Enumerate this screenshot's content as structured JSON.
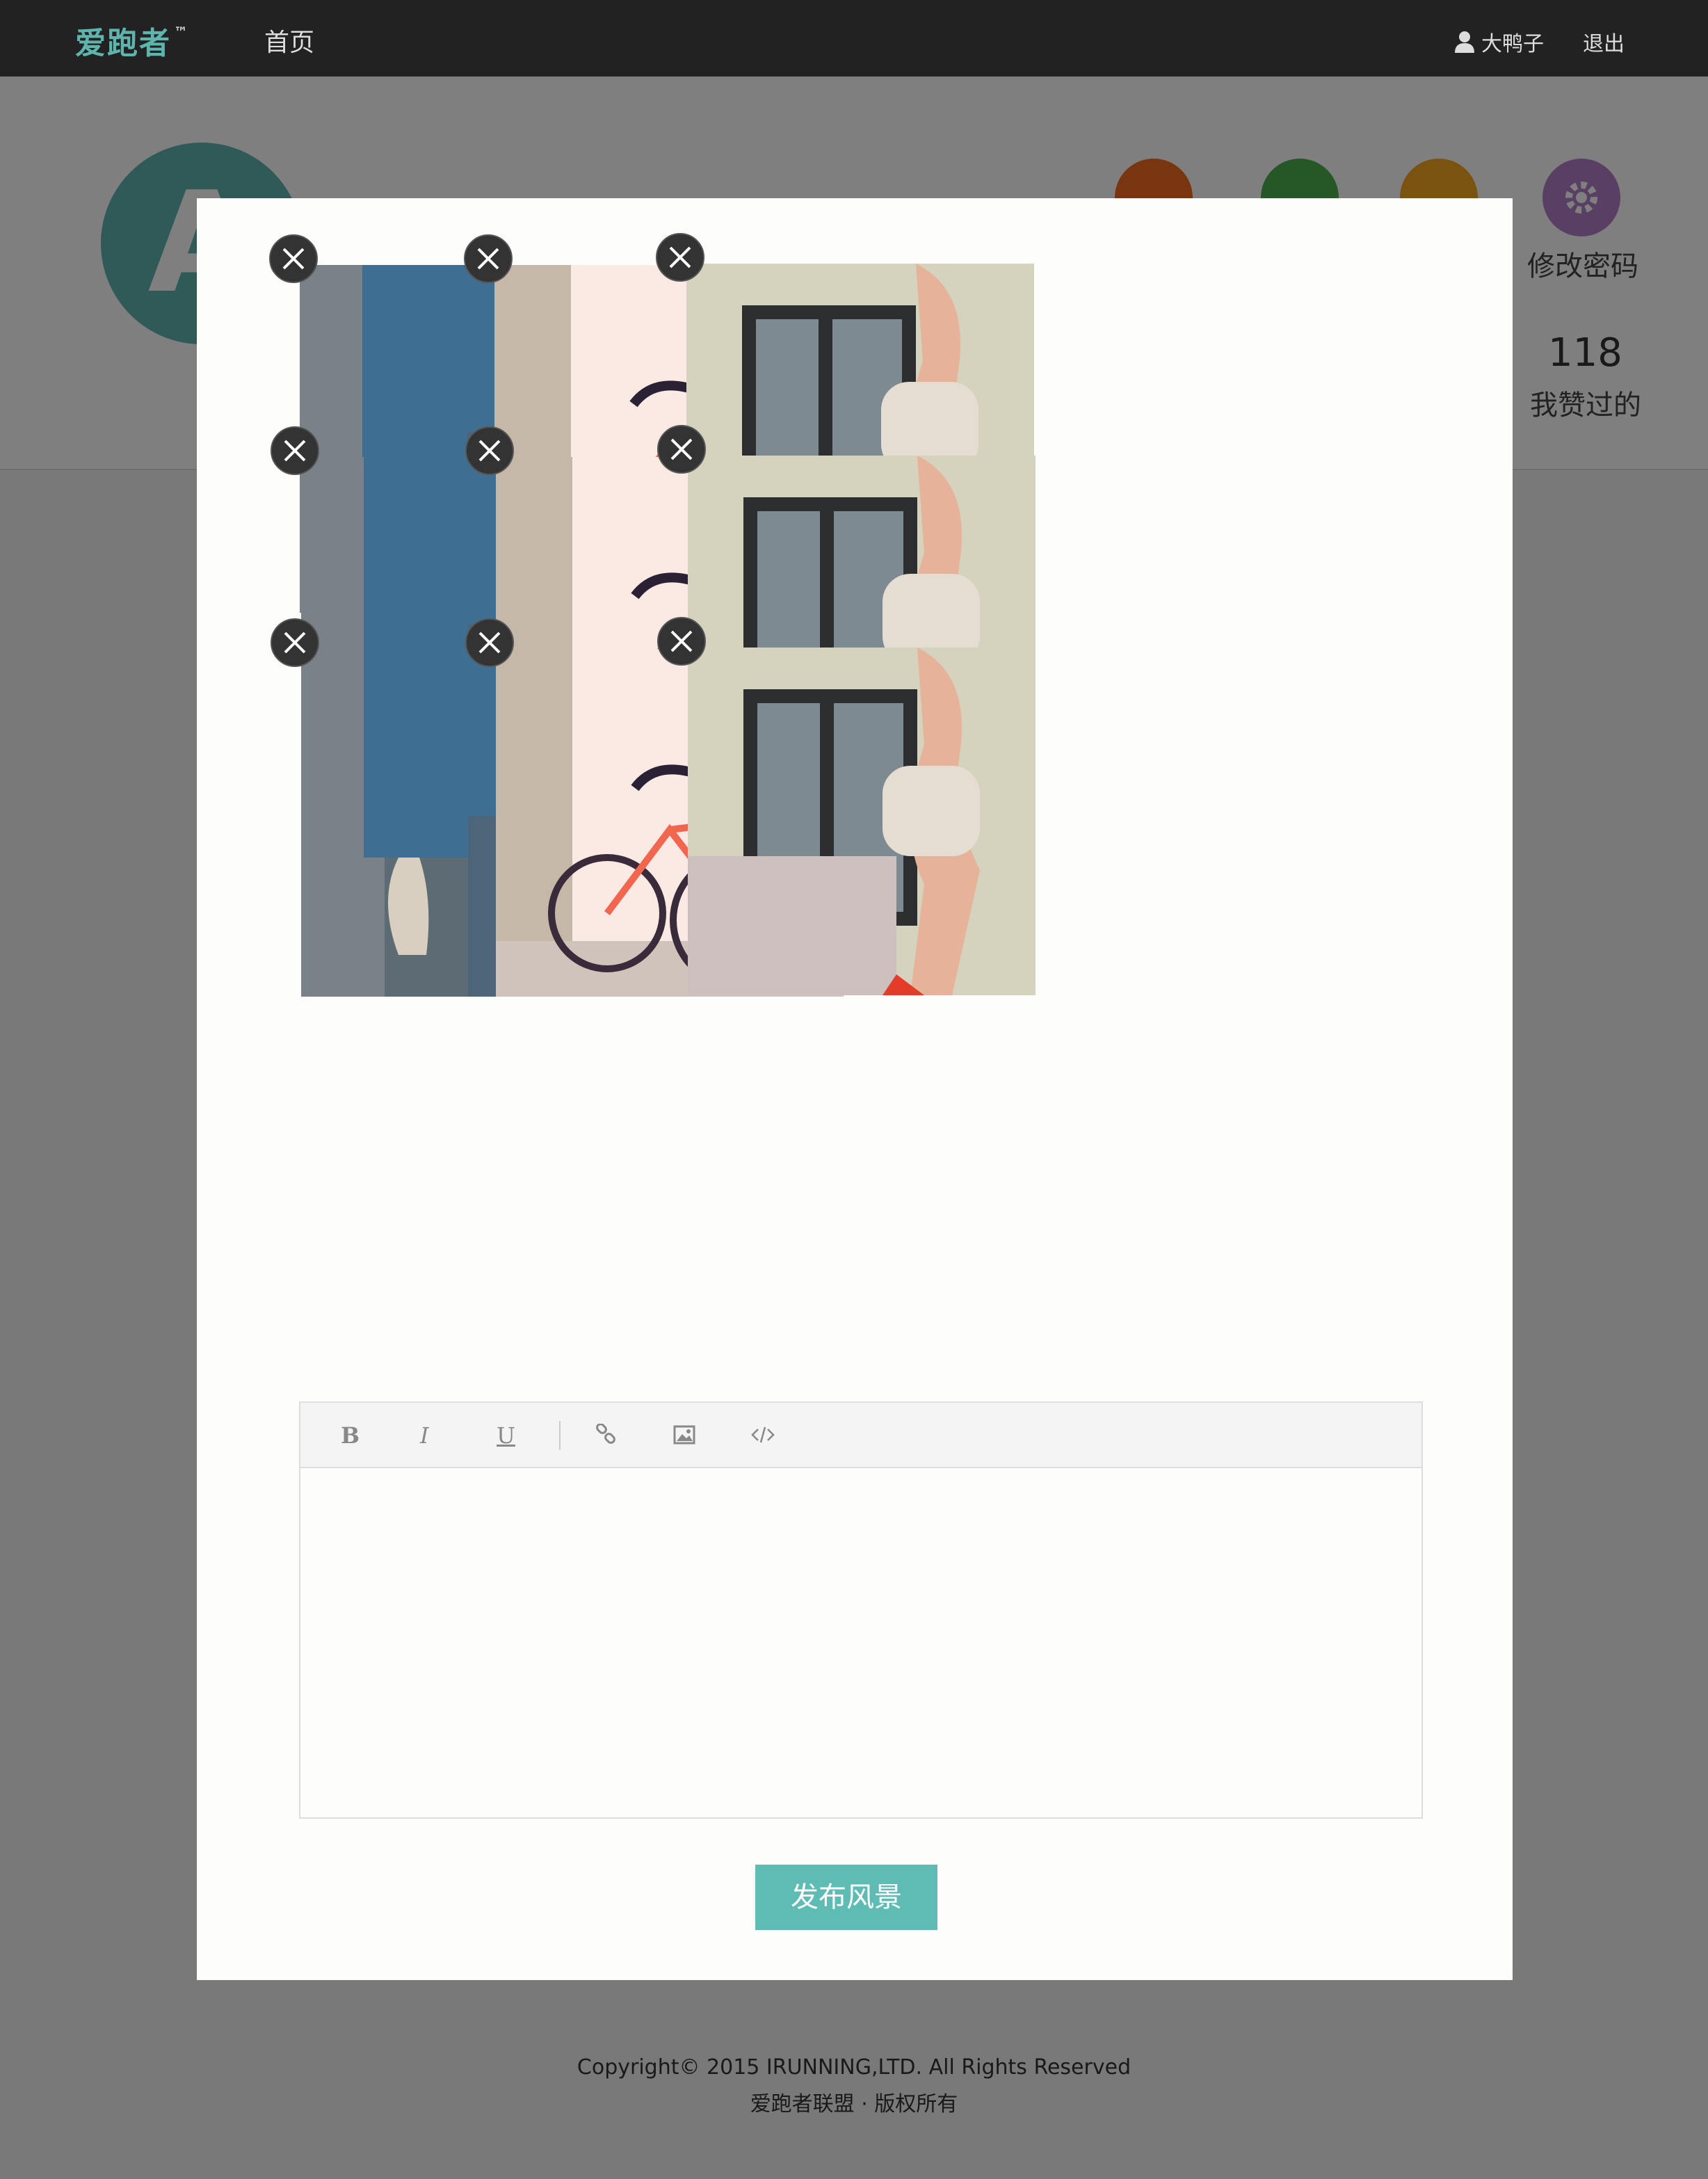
{
  "topbar": {
    "logo": "爱跑者",
    "logo_mark": "™",
    "nav_home": "首页",
    "username": "大鸭子",
    "logout": "退出"
  },
  "profile": {
    "avatar_letter": "A",
    "change_password_label": "修改密码",
    "liked_count": "118",
    "liked_label": "我赞过的"
  },
  "upload_modal": {
    "images": [
      {
        "subject": "camera"
      },
      {
        "subject": "bicycle"
      },
      {
        "subject": "woman"
      },
      {
        "subject": "camera"
      },
      {
        "subject": "bicycle"
      },
      {
        "subject": "woman"
      },
      {
        "subject": "camera"
      },
      {
        "subject": "bicycle"
      },
      {
        "subject": "woman"
      }
    ],
    "toolbar": {
      "bold": "B",
      "italic": "I",
      "underline": "U",
      "link_icon": "link-icon",
      "image_icon": "image-icon",
      "code_icon": "code-icon"
    },
    "editor_text": "",
    "publish_label": "发布风景"
  },
  "footer": {
    "copyright": "Copyright© 2015 IRUNNING,LTD. All Rights Reserved",
    "rights": "爱跑者联盟 · 版权所有"
  },
  "colors": {
    "brand": "#5fbcb5",
    "topbar": "#222222",
    "overlay": "rgba(0,0,0,0.5)"
  }
}
